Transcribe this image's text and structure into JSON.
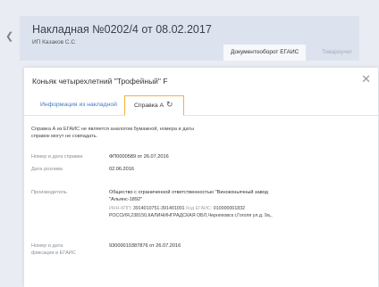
{
  "header": {
    "back_icon": "chevron-left-icon",
    "title": "Накладная №0202/4 от 08.02.2017",
    "subtitle": "ИП Казаков С.С",
    "tabs": [
      "Документооборот ЕГАИС",
      "Товароучет"
    ]
  },
  "modal": {
    "title": "Коньяк четырехлетний \"Трофейный\" F",
    "close_icon": "close-icon",
    "tabs": {
      "info_label": "Информация из накладной",
      "spravka_label": "Справка А",
      "spravka_icon": "refresh-icon"
    },
    "note": "Справка А из ЕГАИС не является аналогом бумажной, номера и даты справок могут не совпадать.",
    "fields": {
      "number_date_label": "Номер и дата справки",
      "number_date_value": "ФП0000589 от 26.07.2016",
      "bottling_date_label": "Дата розлива",
      "bottling_date_value": "02.06.2016",
      "producer_label": "Производитель",
      "producer_name": "Общество с ограниченной ответственностью \"Виноконьячный завод \"Альянс-1892\"",
      "producer_inn_prefix": "ИНН-КПП:",
      "producer_inn": "3914010751-391401001",
      "producer_code_prefix": "Код ЕГАИС:",
      "producer_code": "010000001832",
      "producer_address": "РОССИЯ,238150,КАЛИНИНГРАДСКАЯ ОБЛ,Черняховск г,Гоголя ул.д. 9а,,",
      "egais_label": "Номер и дата фиксации в ЕГАИС",
      "egais_value": "93000010387876 от 26.07.2016"
    }
  }
}
